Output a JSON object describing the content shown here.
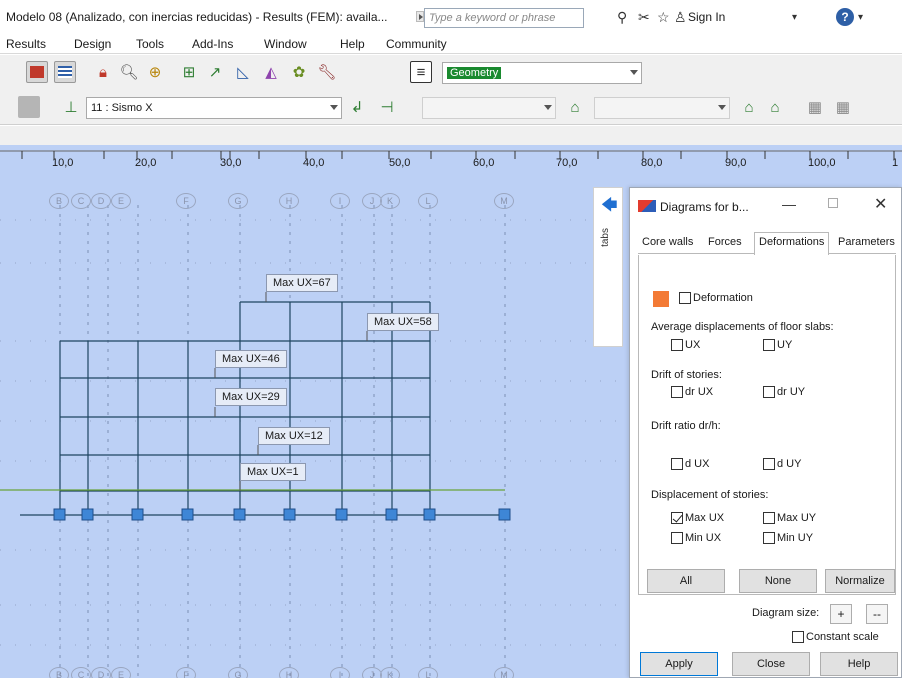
{
  "window": {
    "title": "Modelo 08 (Analizado, con inercias reducidas) - Results (FEM): availa...",
    "search_placeholder": "Type a keyword or phrase",
    "sign_in": "Sign In",
    "help": "?"
  },
  "menu": [
    "Results",
    "Design",
    "Tools",
    "Add-Ins",
    "Window",
    "Help",
    "Community"
  ],
  "toolbar1": {
    "icons": [
      "calculator-icon",
      "table-icon",
      "lock-icon",
      "zoom-icon",
      "pan-zoom-icon",
      "grid-icon",
      "axes-icon",
      "diagram-icon",
      "diagram2-icon",
      "bug-icon",
      "tools-icon",
      "notes-icon"
    ],
    "view_select": "Geometry"
  },
  "toolbar2": {
    "load_case": "11 : Sismo X"
  },
  "ruler": {
    "ticks": [
      "10,0",
      "20,0",
      "30,0",
      "40,0",
      "50,0",
      "60,0",
      "70,0",
      "80,0",
      "90,0",
      "100,0",
      "1"
    ]
  },
  "axes": [
    "B",
    "C",
    "D",
    "E",
    "F",
    "G",
    "H",
    "I",
    "J",
    "K",
    "L",
    "M"
  ],
  "ux_labels": [
    "Max UX=67",
    "Max UX=58",
    "Max UX=46",
    "Max UX=29",
    "Max UX=12",
    "Max UX=1"
  ],
  "side_tab": {
    "label": "tabs"
  },
  "dialog": {
    "title": "Diagrams for b...",
    "tabs": [
      "Core walls",
      "Forces",
      "Deformations",
      "Parameters"
    ],
    "active_tab": "Deformations",
    "deformation_label": "Deformation",
    "avg_displacements_label": "Average displacements of floor slabs:",
    "ux": "UX",
    "uy": "UY",
    "drift_label": "Drift of stories:",
    "dr_ux": "dr UX",
    "dr_uy": "dr UY",
    "drift_ratio_label": "Drift ratio dr/h:",
    "d_ux": "d UX",
    "d_uy": "d UY",
    "disp_stories_label": "Displacement of stories:",
    "max_ux": "Max UX",
    "max_uy": "Max UY",
    "min_ux": "Min UX",
    "min_uy": "Min UY",
    "btn_all": "All",
    "btn_none": "None",
    "btn_normalize": "Normalize",
    "diagram_size_label": "Diagram size:",
    "plus": "+",
    "minus": "--",
    "constant_scale": "Constant scale",
    "btn_apply": "Apply",
    "btn_close": "Close",
    "btn_help": "Help",
    "accent": "#f37a35"
  }
}
